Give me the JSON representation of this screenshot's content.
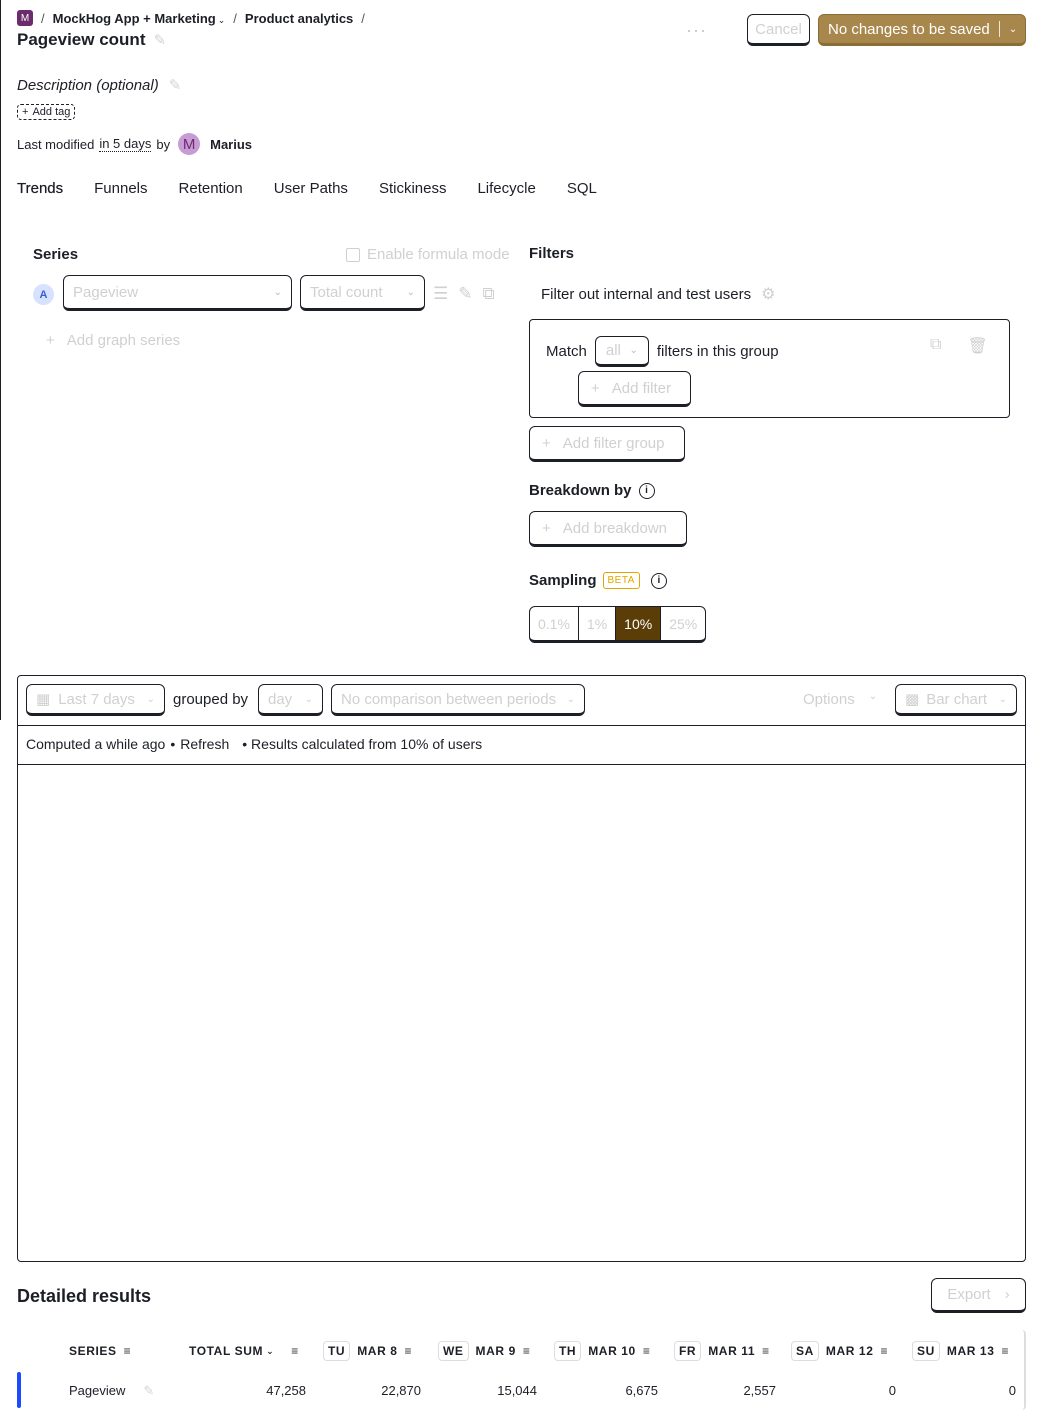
{
  "breadcrumb": {
    "project_badge": "M",
    "project": "MockHog App + Marketing",
    "section": "Product analytics"
  },
  "insight": {
    "title": "Pageview count",
    "description_placeholder": "Description (optional)",
    "add_tag": "Add tag"
  },
  "modified": {
    "prefix": "Last modified",
    "when": "in 5 days",
    "by": "by",
    "avatar_letter": "M",
    "user": "Marius"
  },
  "header_actions": {
    "more": "···",
    "cancel": "Cancel",
    "save": "No changes to be saved"
  },
  "tabs": [
    "Trends",
    "Funnels",
    "Retention",
    "User Paths",
    "Stickiness",
    "Lifecycle",
    "SQL"
  ],
  "active_tab": "Trends",
  "series": {
    "heading": "Series",
    "formula_mode": "Enable formula mode",
    "letter": "A",
    "event": "Pageview",
    "math": "Total count",
    "add_series": "Add graph series"
  },
  "filters": {
    "heading": "Filters",
    "test_users": "Filter out internal and test users",
    "match_label": "Match",
    "match_value": "all",
    "match_suffix": "filters in this group",
    "add_filter": "Add filter",
    "add_filter_group": "Add filter group"
  },
  "breakdown": {
    "heading": "Breakdown by",
    "add": "Add breakdown"
  },
  "sampling": {
    "heading": "Sampling",
    "badge": "BETA",
    "options": [
      "0.1%",
      "1%",
      "10%",
      "25%"
    ],
    "selected": "10%"
  },
  "chart_toolbar": {
    "date_range": "Last 7 days",
    "grouped_by": "grouped by",
    "interval": "day",
    "compare": "No comparison between periods",
    "options": "Options",
    "display": "Bar chart"
  },
  "status": {
    "computed": "Computed a while ago",
    "bullet": "•",
    "refresh": "Refresh",
    "sampling_note": "• Results calculated from 10% of users"
  },
  "results": {
    "heading": "Detailed results",
    "export": "Export",
    "columns": [
      {
        "label": "SERIES"
      },
      {
        "label": "TOTAL SUM",
        "has_caret": true
      },
      {
        "dow": "TU",
        "label": "MAR 8"
      },
      {
        "dow": "WE",
        "label": "MAR 9"
      },
      {
        "dow": "TH",
        "label": "MAR 10"
      },
      {
        "dow": "FR",
        "label": "MAR 11"
      },
      {
        "dow": "SA",
        "label": "MAR 12"
      },
      {
        "dow": "SU",
        "label": "MAR 13"
      }
    ],
    "rows": [
      {
        "series": "Pageview",
        "total": "47,258",
        "values": [
          "22,870",
          "15,044",
          "6,675",
          "2,557",
          "0",
          "0"
        ]
      }
    ]
  },
  "colors": {
    "primary_button": "#a8874c",
    "sampling_selected": "#5a3d07",
    "series_accent": "#1d4aff",
    "beta": "#e5a400"
  }
}
